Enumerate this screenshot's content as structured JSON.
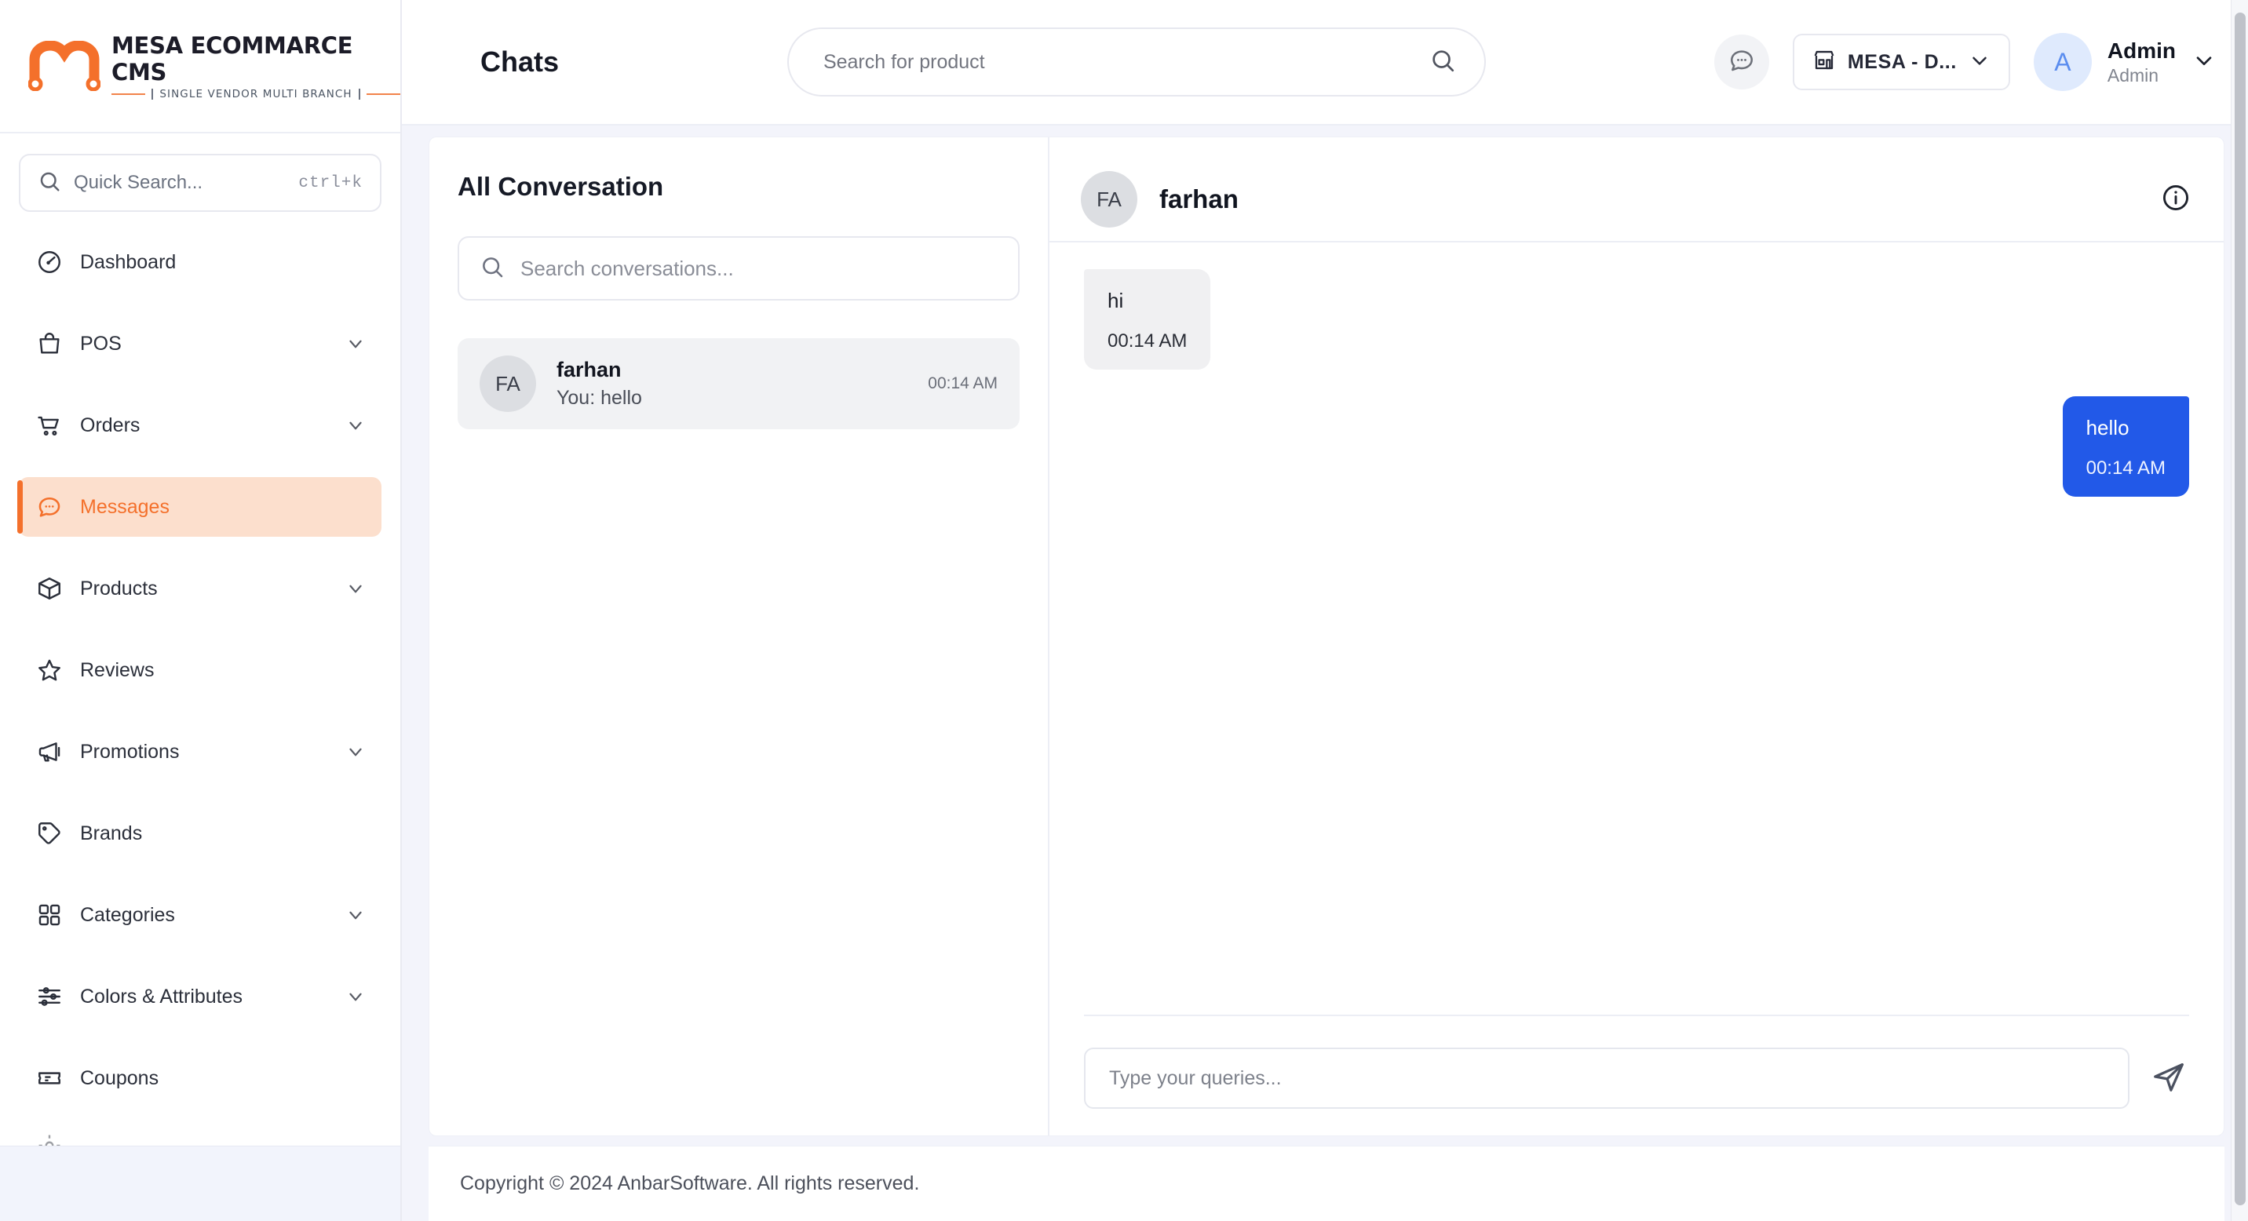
{
  "brand": {
    "title": "MESA ECOMMARCE CMS",
    "subtitle": "SINGLE VENDOR MULTI BRANCH",
    "accent": "#f4702b",
    "logo_icon": "mesa-m-logo"
  },
  "colors": {
    "accent_orange": "#f4702b",
    "active_nav_bg": "#fcdfcd",
    "outgoing_bubble": "#2259e8",
    "incoming_bubble": "#f0f0f2",
    "page_bg": "#f3f4fb",
    "avatar_blue": "#dfeafd"
  },
  "sidebar": {
    "quick_search": {
      "placeholder": "Quick Search...",
      "shortcut": "ctrl+k",
      "icon": "search-icon"
    },
    "items": [
      {
        "label": "Dashboard",
        "icon": "gauge-icon",
        "expandable": false,
        "active": false
      },
      {
        "label": "POS",
        "icon": "shopping-bag-icon",
        "expandable": true,
        "active": false
      },
      {
        "label": "Orders",
        "icon": "shopping-cart-icon",
        "expandable": true,
        "active": false
      },
      {
        "label": "Messages",
        "icon": "chat-bubble-icon",
        "expandable": false,
        "active": true
      },
      {
        "label": "Products",
        "icon": "box-icon",
        "expandable": true,
        "active": false
      },
      {
        "label": "Reviews",
        "icon": "star-icon",
        "expandable": false,
        "active": false
      },
      {
        "label": "Promotions",
        "icon": "megaphone-icon",
        "expandable": true,
        "active": false
      },
      {
        "label": "Brands",
        "icon": "tag-icon",
        "expandable": false,
        "active": false
      },
      {
        "label": "Categories",
        "icon": "grid-icon",
        "expandable": true,
        "active": false
      },
      {
        "label": "Colors & Attributes",
        "icon": "sliders-icon",
        "expandable": true,
        "active": false
      },
      {
        "label": "Coupons",
        "icon": "ticket-icon",
        "expandable": false,
        "active": false
      }
    ]
  },
  "topbar": {
    "page_title": "Chats",
    "search": {
      "placeholder": "Search for product",
      "icon": "search-icon"
    },
    "messages_icon": "chat-bubble-icon",
    "branch": {
      "label": "MESA - D...",
      "icon": "store-icon",
      "chevron": "chevron-down-icon"
    },
    "user": {
      "initial": "A",
      "name": "Admin",
      "role": "Admin",
      "chevron": "chevron-down-icon"
    }
  },
  "conversations": {
    "heading": "All Conversation",
    "search": {
      "placeholder": "Search conversations...",
      "icon": "search-icon"
    },
    "items": [
      {
        "initials": "FA",
        "name": "farhan",
        "snippet": "You: hello",
        "time": "00:14 AM",
        "selected": true
      }
    ]
  },
  "thread": {
    "header": {
      "initials": "FA",
      "name": "farhan",
      "info_icon": "info-circle-icon"
    },
    "messages": [
      {
        "direction": "in",
        "text": "hi",
        "time": "00:14 AM"
      },
      {
        "direction": "out",
        "text": "hello",
        "time": "00:14 AM"
      }
    ],
    "composer": {
      "placeholder": "Type your queries...",
      "value": "",
      "send_icon": "send-icon"
    }
  },
  "footer": {
    "text": "Copyright © 2024 AnbarSoftware. All rights reserved."
  }
}
